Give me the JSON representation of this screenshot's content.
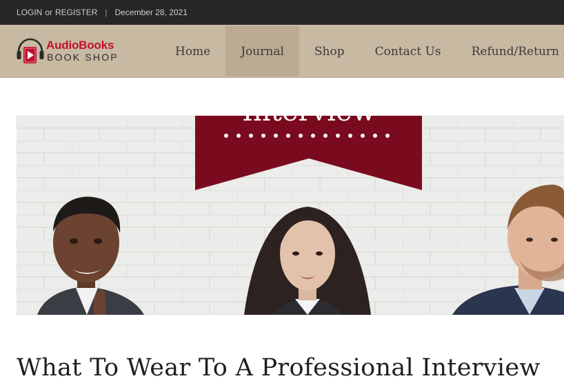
{
  "topbar": {
    "login": "LOGIN",
    "or": "or",
    "register": "REGISTER",
    "separator": "|",
    "date": "December 28, 2021"
  },
  "logo": {
    "line1": "AudioBooks",
    "line2": "BOOK SHOP",
    "brand_color": "#c1122f"
  },
  "nav": {
    "items": [
      {
        "label": "Home"
      },
      {
        "label": "Journal",
        "active": true
      },
      {
        "label": "Shop"
      },
      {
        "label": "Contact Us"
      },
      {
        "label": "Refund/Return Poli"
      }
    ]
  },
  "hero": {
    "banner_text": "Interview",
    "banner_color": "#7a0a1e"
  },
  "post": {
    "title": "What To Wear To A Professional Interview"
  }
}
